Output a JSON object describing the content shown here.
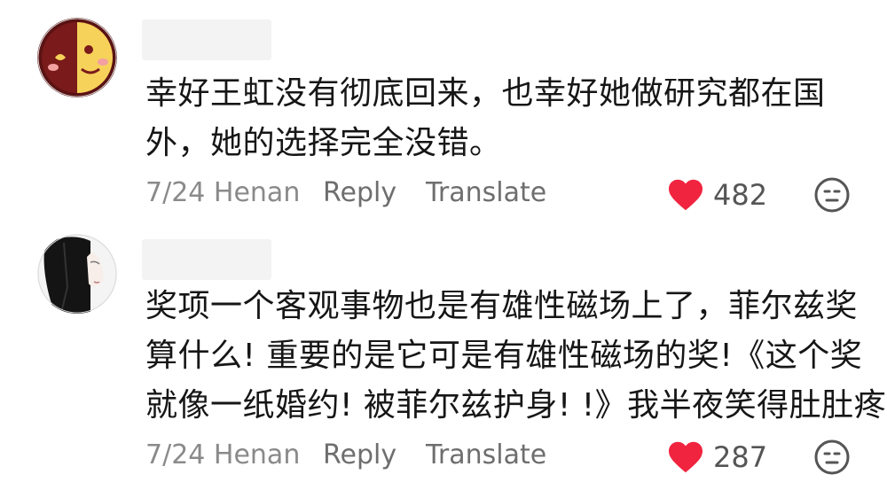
{
  "comments": [
    {
      "avatar_icon": "cartoon-face-avatar",
      "lines": [
        "幸好王虹没有彻底回来，也幸好她做研究都在国",
        "外，她的选择完全没错。"
      ],
      "date_location": "7/24 Henan",
      "reply_label": "Reply",
      "translate_label": "Translate",
      "likes": "482",
      "like_icon": "heart-icon",
      "emoji_icon": "emoji-face-icon"
    },
    {
      "avatar_icon": "anime-girl-avatar",
      "lines": [
        "奖项一个客观事物也是有雄性磁场上了，菲尔兹奖",
        "算什么! 重要的是它可是有雄性磁场的奖!《这个奖",
        "就像一纸婚约! 被菲尔兹护身! !》我半夜笑得肚肚疼"
      ],
      "date_location": "7/24 Henan",
      "reply_label": "Reply",
      "translate_label": "Translate",
      "likes": "287",
      "like_icon": "heart-icon",
      "emoji_icon": "emoji-face-icon"
    }
  ],
  "colors": {
    "heart": "#f0243f",
    "text": "#161616",
    "meta": "#8a8a8a"
  }
}
